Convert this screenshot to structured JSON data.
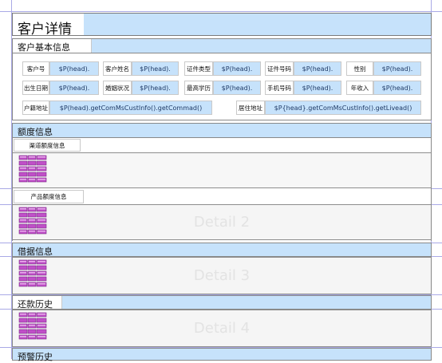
{
  "page_title": "客户详情",
  "basic_section": {
    "label": "客户基本信息"
  },
  "fields": [
    {
      "label": "客户号",
      "value": "$P(head)."
    },
    {
      "label": "客户姓名",
      "value": "$P(head)."
    },
    {
      "label": "证件类型",
      "value": "$P(head)."
    },
    {
      "label": "证件号码",
      "value": "$P(head)."
    },
    {
      "label": "性别",
      "value": "$P(head)."
    },
    {
      "label": "出生日期",
      "value": "$P(head)."
    },
    {
      "label": "婚姻状况",
      "value": "$P(head)."
    },
    {
      "label": "最高学历",
      "value": "$P(head)."
    },
    {
      "label": "手机号码",
      "value": "$P(head)."
    },
    {
      "label": "年收入",
      "value": "$P(head)."
    }
  ],
  "address": {
    "household_label": "户籍地址",
    "household_value": "$P(head).getComMsCustInfo().getCommad()",
    "residence_label": "居住地址",
    "residence_value": "$P{head}.getComMsCustInfo().getLivead()"
  },
  "sections": {
    "credit": "额度信息",
    "channel_credit": "渠道额度信息",
    "product_credit": "产品额度信息",
    "loan": "借据信息",
    "repayment": "还款历史",
    "warning": "预警历史"
  },
  "details": {
    "detail2": "Detail 2",
    "detail3": "Detail 3",
    "detail4": "Detail 4"
  },
  "icons": {
    "table": "table-report-icon"
  },
  "colors": {
    "accent": "#c6e2fb",
    "icon_purple": "#c04fc8"
  }
}
